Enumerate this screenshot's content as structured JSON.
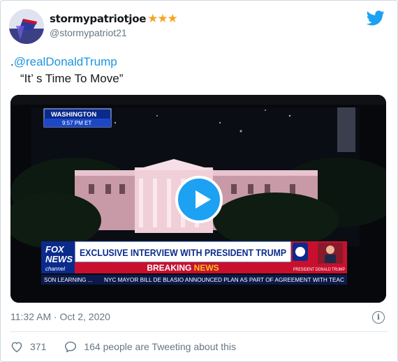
{
  "user": {
    "display_name": "stormypatriotjoe",
    "stars": "★★★",
    "handle": "@stormypatriot21"
  },
  "tweet": {
    "prefix": ".",
    "mention": "@realDonaldTrump",
    "quote": "“It’  s Time To Move”"
  },
  "video": {
    "location": "WASHINGTON",
    "time": "9:57 PM ET",
    "logo_line1": "FOX",
    "logo_line2": "NEWS",
    "logo_line3": "channel",
    "headline": "EXCLUSIVE INTERVIEW WITH PRESIDENT TRUMP",
    "breaking_word1": "BREAKING",
    "breaking_word2": "NEWS",
    "side_caption": "PRESIDENT DONALD TRUMP",
    "ticker_left": "SON LEARNING ...",
    "ticker_right": "NYC MAYOR BILL DE BLASIO ANNOUNCED PLAN AS PART OF AGREEMENT WITH TEAC"
  },
  "meta": {
    "timestamp": "11:32 AM · Oct 2, 2020",
    "info_symbol": "i"
  },
  "actions": {
    "likes": "371",
    "people_tweeting": "164 people are Tweeting about this"
  },
  "colors": {
    "link": "#1b95e0",
    "play": "#1da1f2",
    "star": "#f5a623",
    "fox_red": "#c8102e",
    "fox_blue": "#0a2a8c"
  }
}
